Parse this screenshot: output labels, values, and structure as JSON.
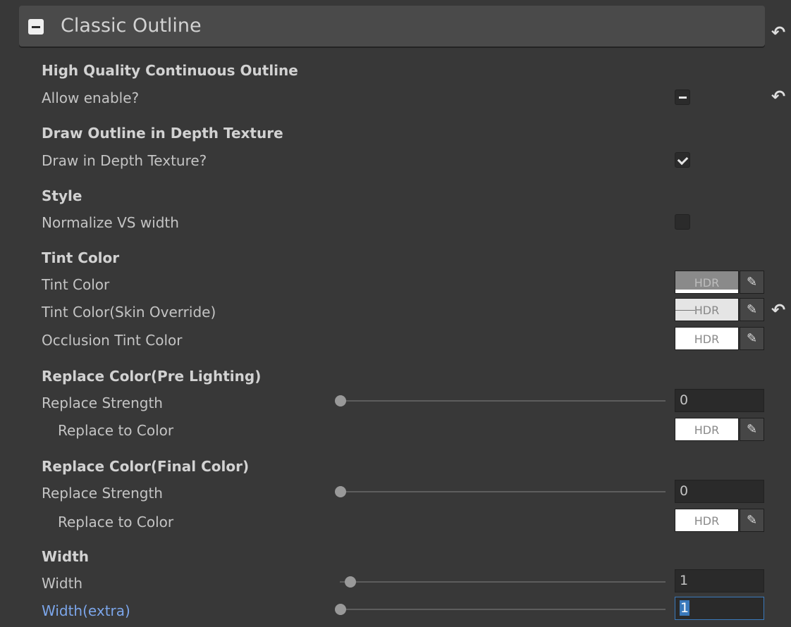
{
  "header": {
    "title": "Classic Outline"
  },
  "sections": {
    "hq": {
      "title": "High Quality Continuous Outline",
      "allow": "Allow enable?"
    },
    "depth": {
      "title": "Draw Outline in Depth Texture",
      "draw": "Draw in Depth Texture?"
    },
    "style": {
      "title": "Style",
      "normalize": "Normalize VS width"
    },
    "tint": {
      "title": "Tint Color",
      "tint_color": "Tint Color",
      "tint_skin": "Tint Color(Skin Override)",
      "occlusion": "Occlusion Tint Color",
      "hdr": "HDR"
    },
    "replace_pre": {
      "title": "Replace Color(Pre Lighting)",
      "strength": "Replace Strength",
      "strength_value": "0",
      "to_color": "Replace to Color"
    },
    "replace_final": {
      "title": "Replace Color(Final Color)",
      "strength": "Replace Strength",
      "strength_value": "0",
      "to_color": "Replace to Color"
    },
    "width": {
      "title": "Width",
      "width": "Width",
      "width_value": "1",
      "width_extra": "Width(extra)",
      "width_extra_value": "1"
    }
  },
  "states": {
    "allow_enable": "mixed",
    "draw_in_depth": true,
    "normalize_vs_width": false
  },
  "colors": {
    "background": "#383838",
    "header": "#4a4a4a",
    "focus": "#3a79bb",
    "active_label": "#7ca6ea"
  },
  "icons": {
    "revert": "revert-icon",
    "picker": "eyedropper-icon"
  }
}
